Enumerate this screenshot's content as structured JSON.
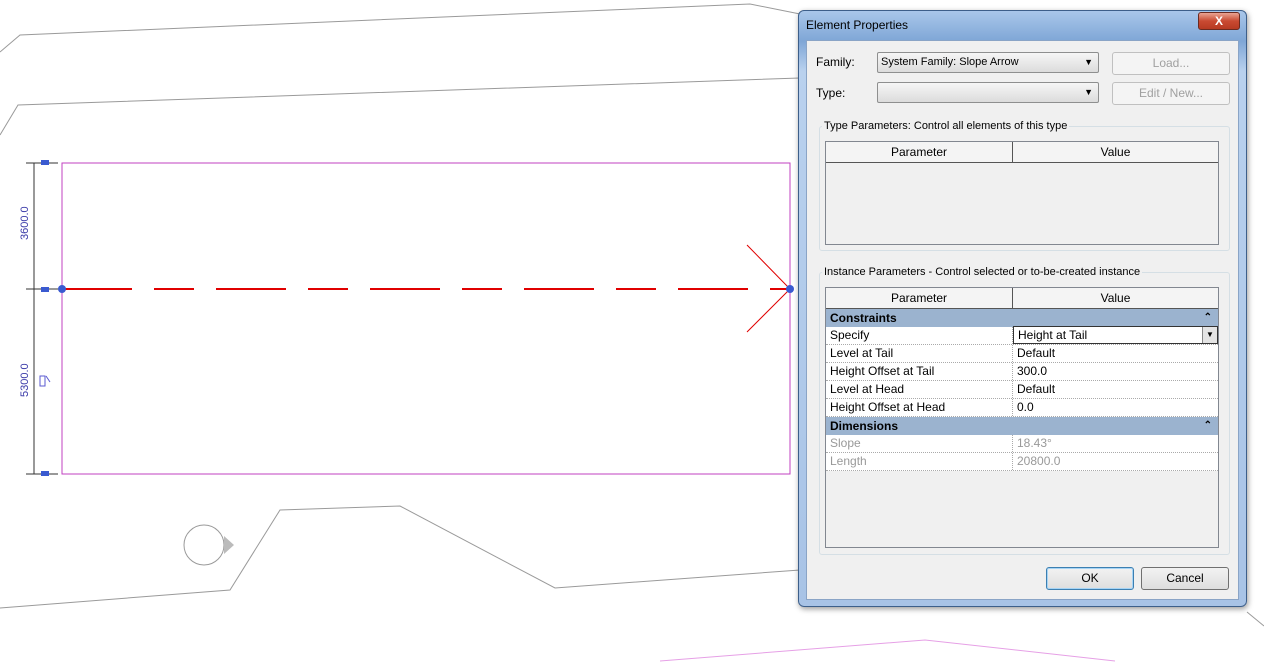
{
  "drawing": {
    "dim_upper": "3600.0",
    "dim_lower": "5300.0",
    "colors": {
      "slope_arrow": "#e00000",
      "boundary": "#c040c0",
      "dimension": "#3a3aa8",
      "context": "#9a9a9a"
    }
  },
  "dialog": {
    "title": "Element Properties",
    "close_label": "X",
    "family_label": "Family:",
    "family_value": "System Family: Slope Arrow",
    "type_label": "Type:",
    "type_value": "",
    "load_button": "Load...",
    "edit_new_button": "Edit / New...",
    "type_params_group": "Type Parameters: Control all elements of this type",
    "instance_params_group": "Instance Parameters - Control selected or to-be-created instance",
    "col_parameter": "Parameter",
    "col_value": "Value",
    "sections": [
      {
        "name": "Constraints",
        "rows": [
          {
            "param": "Specify",
            "value": "Height at Tail"
          },
          {
            "param": "Level at Tail",
            "value": "Default"
          },
          {
            "param": "Height Offset at Tail",
            "value": "300.0"
          },
          {
            "param": "Level at Head",
            "value": "Default"
          },
          {
            "param": "Height Offset at Head",
            "value": "0.0"
          }
        ]
      },
      {
        "name": "Dimensions",
        "rows": [
          {
            "param": "Slope",
            "value": "18.43°"
          },
          {
            "param": "Length",
            "value": "20800.0"
          }
        ]
      }
    ],
    "ok_button": "OK",
    "cancel_button": "Cancel"
  }
}
